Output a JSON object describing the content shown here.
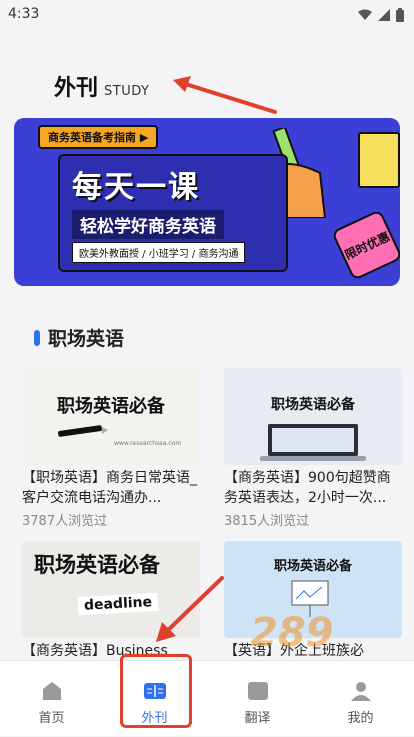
{
  "status": {
    "time": "4:33"
  },
  "header": {
    "title": "外刊",
    "subtitle": "STUDY"
  },
  "banner": {
    "tag": "商务英语备考指南 ▶",
    "headline": "每天一课",
    "subline": "轻松学好商务英语",
    "features": "欧美外教面授 / 小班学习 / 商务沟通",
    "badge": "限时优惠"
  },
  "section": {
    "title": "职场英语"
  },
  "cards": [
    {
      "thumb_title": "职场英语必备",
      "thumb_sub": "www.researchsea.com",
      "title": "【职场英语】商务日常英语_客户交流电话沟通办...",
      "views": "3787人浏览过"
    },
    {
      "thumb_title": "职场英语必备",
      "title": "【商务英语】900句超赞商务英语表达，2小时一次...",
      "views": "3815人浏览过"
    },
    {
      "thumb_title": "职场英语必备",
      "thumb_word": "deadline",
      "title": "【商务英语】Business"
    },
    {
      "thumb_title": "职场英语必备",
      "title": "【英语】外企上班族必"
    }
  ],
  "tabs": [
    {
      "label": "首页",
      "icon": "home-icon"
    },
    {
      "label": "外刊",
      "icon": "book-icon",
      "active": true
    },
    {
      "label": "翻译",
      "icon": "translate-icon"
    },
    {
      "label": "我的",
      "icon": "user-icon"
    }
  ],
  "watermark": "289",
  "colors": {
    "accent": "#2f6ff0",
    "annotation": "#e0402c",
    "banner_bg": "#3b3fd6"
  }
}
